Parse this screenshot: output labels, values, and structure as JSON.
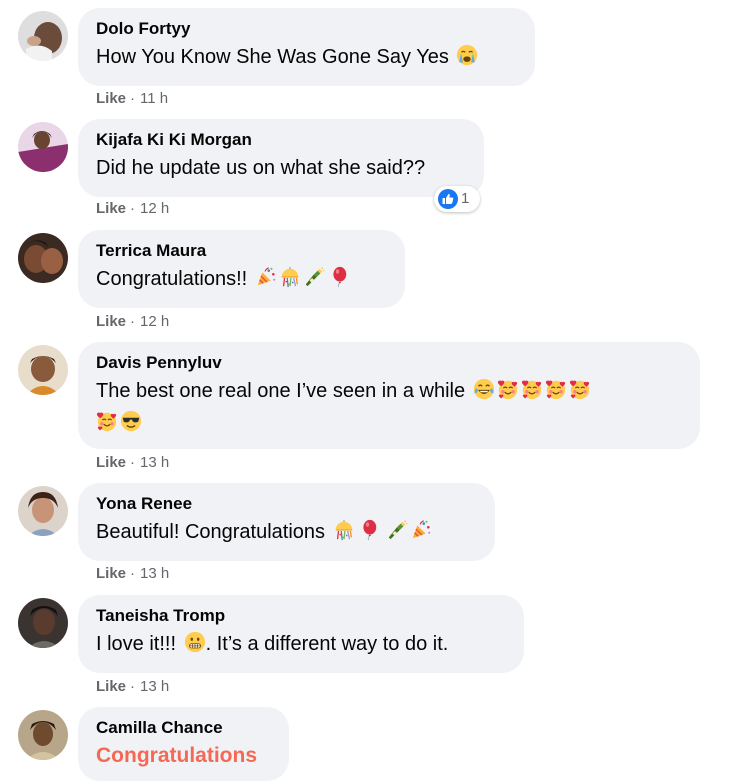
{
  "comments": [
    {
      "author": "Dolo Fortyy",
      "text": "How You Know She Was Gone Say Yes",
      "emojis": [
        "loudly-crying-face"
      ],
      "like_label": "Like",
      "time": "11 h"
    },
    {
      "author": "Kijafa Ki Ki Morgan",
      "text": "Did he update us on what she said??",
      "emojis": [],
      "like_label": "Like",
      "time": "12 h",
      "reactions": {
        "icon": "like-reaction-icon",
        "count": "1",
        "color": "#1877f2"
      }
    },
    {
      "author": "Terrica Maura",
      "text": "Congratulations!!",
      "emojis": [
        "party-popper",
        "confetti-ball",
        "champagne-bottle",
        "red-balloon"
      ],
      "like_label": "Like",
      "time": "12 h"
    },
    {
      "author": "Davis Pennyluv",
      "text": "The best one real one I’ve seen in a while",
      "emojis": [
        "tears-of-joy",
        "smiling-face-with-hearts",
        "smiling-face-with-hearts",
        "smiling-face-with-hearts",
        "smiling-face-with-hearts"
      ],
      "emojis_line2": [
        "smiling-face-with-hearts",
        "smiling-face-with-sunglasses"
      ],
      "like_label": "Like",
      "time": "13 h"
    },
    {
      "author": "Yona Renee",
      "text": "Beautiful! Congratulations",
      "emojis": [
        "confetti-ball",
        "red-balloon",
        "champagne-bottle",
        "party-popper"
      ],
      "like_label": "Like",
      "time": "13 h"
    },
    {
      "author": "Taneisha Tromp",
      "text_before": "I love it!!!",
      "emojis": [
        "grimacing-face"
      ],
      "text_after": ". It’s a different way to do it.",
      "like_label": "Like",
      "time": "13 h"
    },
    {
      "author": "Camilla Chance",
      "text": "Congratulations",
      "text_color": "#f56954"
    }
  ],
  "colors": {
    "bubble": "#f0f2f5",
    "meta_text": "#65676b",
    "accent_blue": "#1877f2",
    "highlight_text": "#f56954"
  }
}
